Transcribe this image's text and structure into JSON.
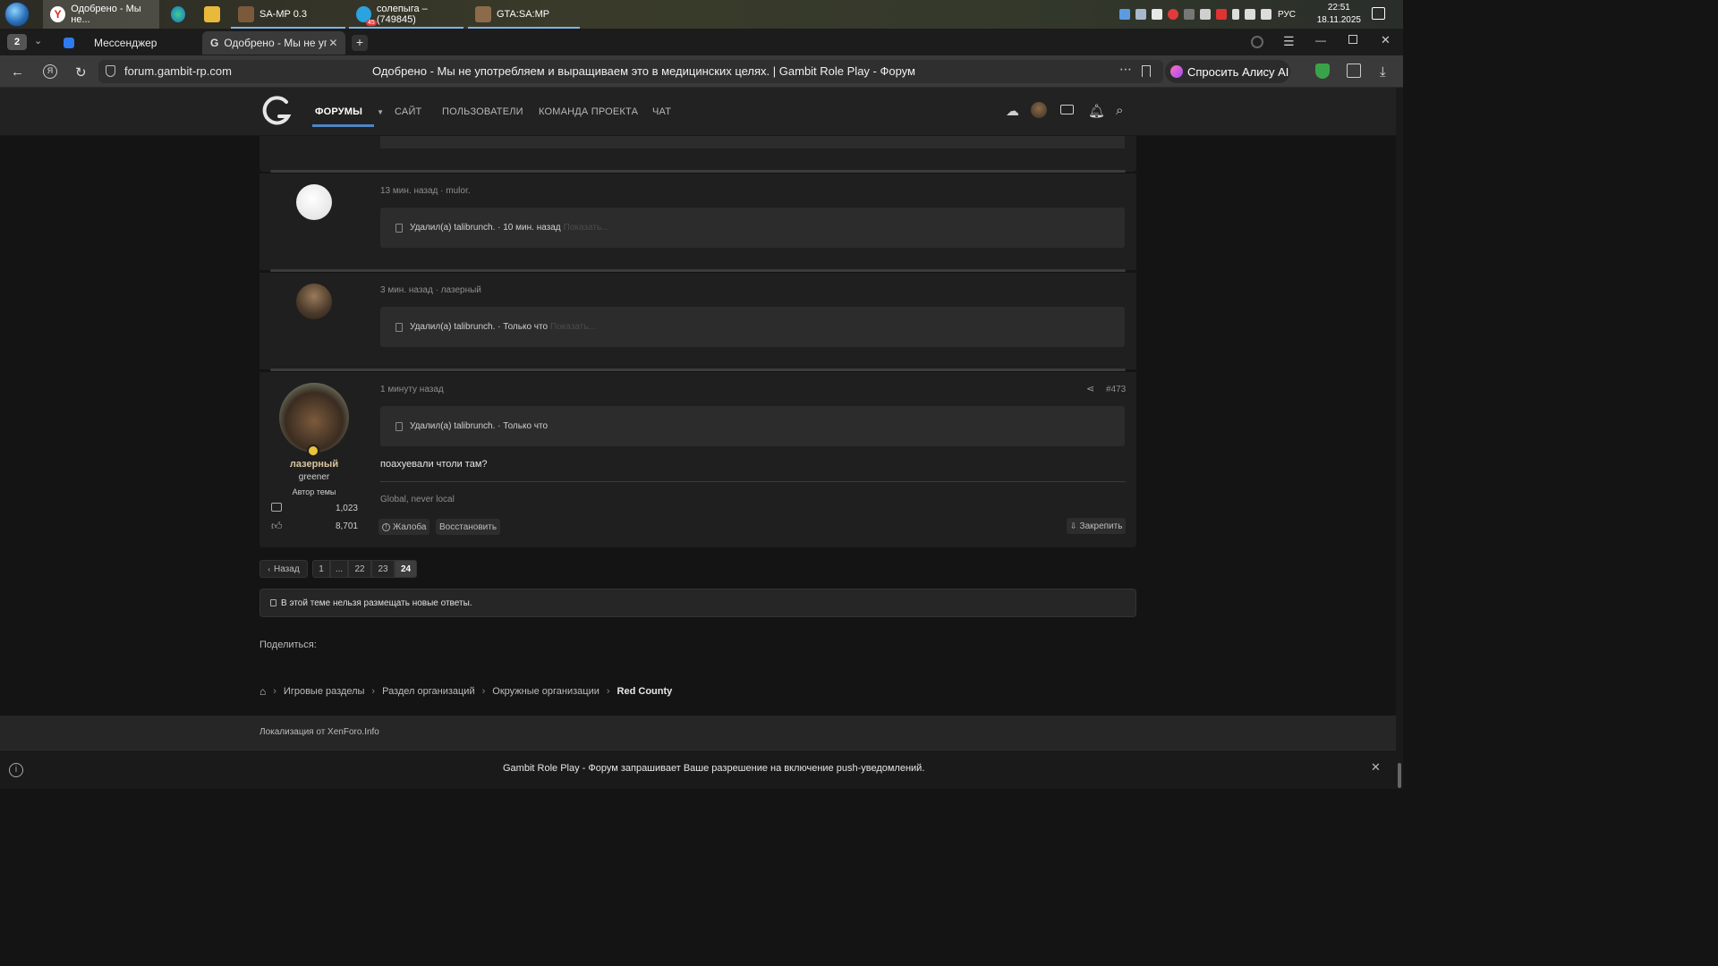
{
  "taskbar": {
    "items": [
      {
        "label": "Одобрено - Мы не..."
      },
      {
        "label": "SA-MP 0.3"
      },
      {
        "label": "солепыга – (749845)"
      },
      {
        "label": "GTA:SA:MP"
      }
    ],
    "telegram_badge": "45",
    "language": "РУС",
    "time": "22:51",
    "date": "18.11.2025"
  },
  "browser": {
    "tab_count": "2",
    "tabs": [
      {
        "label": "Мессенджер"
      },
      {
        "label": "Одобрено - Мы не упо"
      }
    ],
    "url": "forum.gambit-rp.com",
    "page_title": "Одобрено - Мы не употребляем и выращиваем это в медицинских целях. | Gambit Role Play - Форум",
    "alice_label": "Спросить Алису AI"
  },
  "forum_nav": {
    "items": [
      "ФОРУМЫ",
      "САЙТ",
      "ПОЛЬЗОВАТЕЛИ",
      "КОМАНДА ПРОЕКТА",
      "ЧАТ"
    ]
  },
  "posts": [
    {
      "meta": "13 мин. назад · mulor.",
      "deleted_text": "Удалил(а) talibrunch. · 10 мин. назад",
      "show_label": "Показать..."
    },
    {
      "meta": "3 мин. назад · лазерный",
      "deleted_text": "Удалил(а) talibrunch. · Только что",
      "show_label": "Показать..."
    }
  ],
  "last_post": {
    "meta": "1 минуту назад",
    "post_number": "#473",
    "deleted_text": "Удалил(а) talibrunch. · Только что",
    "body": "поахуевали чтоли там?",
    "signature": "Global, never local",
    "author": {
      "name": "лазерный",
      "title": "greener",
      "role": "Автор темы",
      "messages": "1,023",
      "reactions": "8,701"
    },
    "actions": {
      "report": "Жалоба",
      "restore": "Восстановить",
      "pin": "Закрепить"
    }
  },
  "pagination": {
    "prev": "Назад",
    "pages": [
      "1",
      "...",
      "22",
      "23",
      "24"
    ],
    "current": "24"
  },
  "locked_notice": "В этой теме нельзя размещать новые ответы.",
  "share_label": "Поделиться:",
  "breadcrumbs": [
    "Игровые разделы",
    "Раздел организаций",
    "Окружные организации",
    "Red County"
  ],
  "footer_text": "Локализация от XenForo.Info",
  "push_text": "Gambit Role Play - Форум запрашивает Ваше разрешение на включение push-уведомлений.",
  "colors": {
    "accent_line": "#4d86c4",
    "background": "#141414",
    "post_bg": "#1f1f1f",
    "username": "#d9c6a0"
  }
}
